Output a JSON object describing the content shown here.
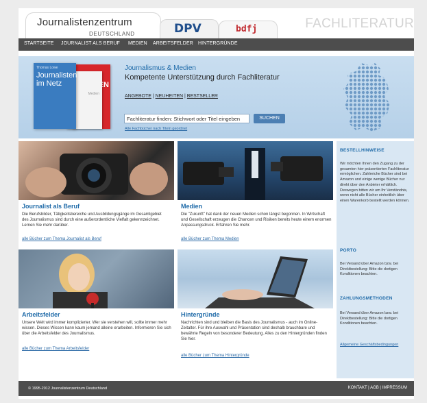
{
  "header": {
    "logo_title": "Journalistenzentrum",
    "logo_subtitle": "DEUTSCHLAND",
    "tab_dpv": "DPV",
    "tab_bdfj": "bdfj",
    "section_title": "FACHLITERATUR"
  },
  "nav": {
    "items": [
      "STARTSEITE",
      "JOURNALIST ALS BERUF",
      "MEDIEN",
      "ARBEITSFELDER",
      "HINTERGRÜNDE"
    ]
  },
  "banner": {
    "book_author": "Thomas Lowe",
    "book_title": "Journalisten im Netz",
    "book_red_text": "STEN",
    "book_white_text": "Medien",
    "heading": "Journalismus & Medien",
    "subheading": "Kompetente Unterstützung durch Fachliteratur",
    "links": [
      "ANGEBOTE",
      "NEUHEITEN",
      "BESTSELLER"
    ],
    "link_separator": " | ",
    "search_label": "Fachliteratur finden: Stichwort oder Titel eingeben",
    "search_button": "SUCHEN",
    "all_books_link": "Alle Fachbücher nach Titeln geordnet"
  },
  "panels": [
    {
      "title": "Journalist als Beruf",
      "text": "Die Berufsbilder, Tätigkeitsbereiche und Ausbildungsgänge im Gesamtgebiet des Journalismus sind durch eine außerordentliche Vielfalt gekennzeichnet. Lernen Sie mehr darüber.",
      "link": "alle Bücher zum Thema Journalist als Beruf"
    },
    {
      "title": "Medien",
      "text": "Die \"Zukunft\" hat dank der neuen Medien schon längst begonnen. In Wirtschaft und Gesellschaft erzeugen die Chancen und Risiken bereits heute einem enormen Anpassungsdruck. Erfahren Sie mehr.",
      "link": "alle Bücher zum Thema Medien"
    },
    {
      "title": "Arbeitsfelder",
      "text": "Unsere Welt wird immer komplizierter. Wer sie verstehen will, sollte immer mehr wissen. Dieses Wissen kann kaum jemand alleine erarbeiten. Informieren Sie sich über die Arbeitsfelder des Journalismus.",
      "link": "alle Bücher zum Thema Arbeitsfelder"
    },
    {
      "title": "Hintergründe",
      "text": "Nachrichten sind und bleiben die Basis des Journalismus - auch im Online-Zeitalter. Für ihre Auswahl und Präsentation sind deshalb brauchbare und bewährte Regeln von besonderer Bedeutung. Alles zu den Hintergründen finden Sie hier.",
      "link": "alle Bücher zum Thema Hintergründe"
    }
  ],
  "sidebar": {
    "bestell_heading": "BESTELLHINWEISE",
    "bestell_text": "Wir möchten Ihnen den Zugang zu der gesamten hier präsentierten Fachliteratur ermöglichen. Zahlreiche Bücher sind bei Amazon und einige wenige Bücher nur direkt über den Anbieter erhältlich. Deswegen bitten wir um Ihr Verständnis, wenn nicht alle Bücher einheitlich über einen Warenkorb bestellt werden können.",
    "porto_heading": "PORTO",
    "porto_text": "Bei Versand über Amazon bzw. bei Direktbestellung: Bitte die dortigen Konditionen beachten.",
    "zahlung_heading": "ZAHLUNGSMETHODEN",
    "zahlung_text": "Bei Versand über Amazon bzw. bei Direktbestellung: Bitte die dortigen Konditionen beachten.",
    "agb_link": "Allgemeine Geschäftsbedingungen"
  },
  "footer": {
    "copyright": "© 1995-2012 Journalistenzentrum Deutschland",
    "links": [
      "KONTAKT",
      "AGB",
      "IMPRESSUM"
    ],
    "separator": " | "
  },
  "colors": {
    "nav_bg": "#4d4d4d",
    "accent_blue": "#1e6aa8",
    "banner_blue": "#c9def0",
    "sidebar_bg": "#d9e7f3",
    "button_blue": "#4c7fb3"
  }
}
